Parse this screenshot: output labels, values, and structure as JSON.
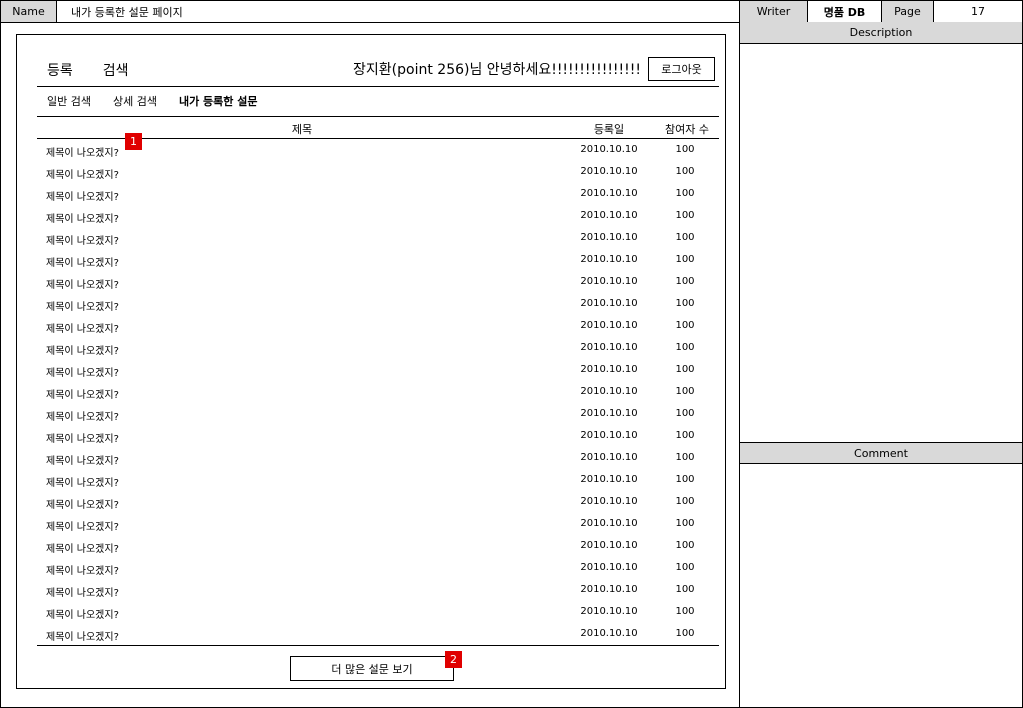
{
  "header": {
    "name_label": "Name",
    "name_value": "내가 등록한 설문 페이지",
    "writer_label": "Writer",
    "writer_value": "명품 DB",
    "page_label": "Page",
    "page_value": "17"
  },
  "right_panel": {
    "description_label": "Description",
    "comment_label": "Comment"
  },
  "screen": {
    "nav": {
      "register": "등록",
      "search": "검색"
    },
    "greeting": "장지환(point 256)님 안녕하세요!!!!!!!!!!!!!!!!",
    "logout_label": "로그아웃",
    "subtabs": {
      "general": "일반 검색",
      "detail": "상세 검색",
      "mine": "내가 등록한 설문"
    },
    "columns": {
      "title": "제목",
      "date": "등록일",
      "count": "참여자 수"
    },
    "rows": [
      {
        "title": "제목이 나오겠지?",
        "date": "2010.10.10",
        "count": "100"
      },
      {
        "title": "제목이 나오겠지?",
        "date": "2010.10.10",
        "count": "100"
      },
      {
        "title": "제목이 나오겠지?",
        "date": "2010.10.10",
        "count": "100"
      },
      {
        "title": "제목이 나오겠지?",
        "date": "2010.10.10",
        "count": "100"
      },
      {
        "title": "제목이 나오겠지?",
        "date": "2010.10.10",
        "count": "100"
      },
      {
        "title": "제목이 나오겠지?",
        "date": "2010.10.10",
        "count": "100"
      },
      {
        "title": "제목이 나오겠지?",
        "date": "2010.10.10",
        "count": "100"
      },
      {
        "title": "제목이 나오겠지?",
        "date": "2010.10.10",
        "count": "100"
      },
      {
        "title": "제목이 나오겠지?",
        "date": "2010.10.10",
        "count": "100"
      },
      {
        "title": "제목이 나오겠지?",
        "date": "2010.10.10",
        "count": "100"
      },
      {
        "title": "제목이 나오겠지?",
        "date": "2010.10.10",
        "count": "100"
      },
      {
        "title": "제목이 나오겠지?",
        "date": "2010.10.10",
        "count": "100"
      },
      {
        "title": "제목이 나오겠지?",
        "date": "2010.10.10",
        "count": "100"
      },
      {
        "title": "제목이 나오겠지?",
        "date": "2010.10.10",
        "count": "100"
      },
      {
        "title": "제목이 나오겠지?",
        "date": "2010.10.10",
        "count": "100"
      },
      {
        "title": "제목이 나오겠지?",
        "date": "2010.10.10",
        "count": "100"
      },
      {
        "title": "제목이 나오겠지?",
        "date": "2010.10.10",
        "count": "100"
      },
      {
        "title": "제목이 나오겠지?",
        "date": "2010.10.10",
        "count": "100"
      },
      {
        "title": "제목이 나오겠지?",
        "date": "2010.10.10",
        "count": "100"
      },
      {
        "title": "제목이 나오겠지?",
        "date": "2010.10.10",
        "count": "100"
      },
      {
        "title": "제목이 나오겠지?",
        "date": "2010.10.10",
        "count": "100"
      },
      {
        "title": "제목이 나오겠지?",
        "date": "2010.10.10",
        "count": "100"
      },
      {
        "title": "제목이 나오겠지?",
        "date": "2010.10.10",
        "count": "100"
      }
    ],
    "more_label": "더 많은 설문 보기"
  },
  "markers": {
    "m1": "1",
    "m2": "2"
  },
  "colors": {
    "marker": "#e00000",
    "label_bg": "#d9d9d9"
  }
}
